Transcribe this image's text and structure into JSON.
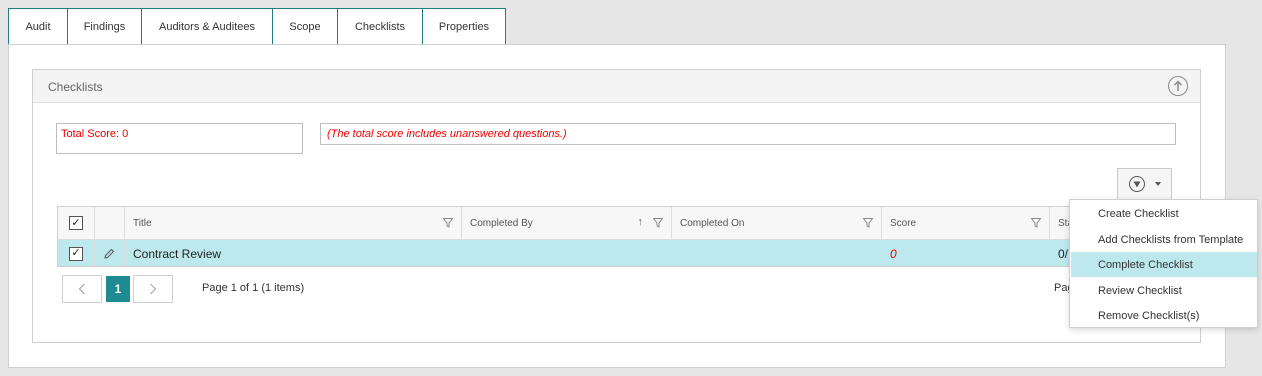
{
  "tabs": [
    {
      "label": "Audit"
    },
    {
      "label": "Findings"
    },
    {
      "label": "Auditors & Auditees"
    },
    {
      "label": "Scope"
    },
    {
      "label": "Checklists"
    },
    {
      "label": "Properties"
    }
  ],
  "active_tab": "Checklists",
  "panel": {
    "title": "Checklists",
    "collapse_icon": "arrow-up-circle-icon"
  },
  "total_score_text": "Total Score: 0",
  "score_note": "(The total score includes unanswered questions.)",
  "colors": {
    "accent": "#1e8a91",
    "tab_border": "#1e7d7d",
    "row_highlight": "#bde9ee",
    "warning_text": "#ee0000"
  },
  "grid": {
    "columns": [
      {
        "label": ""
      },
      {
        "label": ""
      },
      {
        "label": "Title"
      },
      {
        "label": "Completed By"
      },
      {
        "label": "Completed On"
      },
      {
        "label": "Score"
      },
      {
        "label": "Sta"
      }
    ],
    "rows": [
      {
        "title": "Contract Review",
        "completed_by": "",
        "completed_on": "",
        "score": "0",
        "status": "0/",
        "checked": true
      }
    ]
  },
  "pager": {
    "prev_icon": "chevron-left-icon",
    "next_icon": "chevron-right-icon",
    "current_page": "1",
    "info": "Page 1 of 1 (1 items)",
    "right_text": "Pag"
  },
  "actions_menu": {
    "items": [
      {
        "label": "Create Checklist"
      },
      {
        "label": "Add Checklists from Template"
      },
      {
        "label": "Complete Checklist"
      },
      {
        "label": "Review Checklist"
      },
      {
        "label": "Remove Checklist(s)"
      }
    ],
    "highlighted": "Complete Checklist"
  }
}
